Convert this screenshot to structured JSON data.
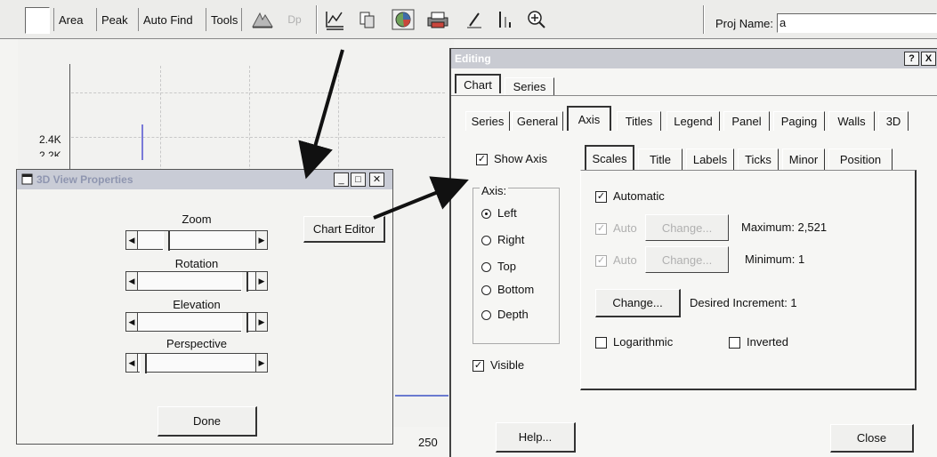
{
  "toolbar": {
    "area": "Area",
    "peak": "Peak",
    "auto_find": "Auto Find",
    "tools": "Tools",
    "dp": "Dp",
    "proj_name_label": "Proj Name:",
    "proj_name_value": "a"
  },
  "chart": {
    "y_ticks": [
      "2.4K",
      "2.2K"
    ],
    "x_tick": "250"
  },
  "view3d": {
    "title": "3D View Properties",
    "chart_editor": "Chart Editor",
    "zoom": "Zoom",
    "rotation": "Rotation",
    "elevation": "Elevation",
    "perspective": "Perspective",
    "done": "Done"
  },
  "editing": {
    "title": "Editing",
    "top_tabs": [
      "Chart",
      "Series"
    ],
    "chart_tabs": [
      "Series",
      "General",
      "Axis",
      "Titles",
      "Legend",
      "Panel",
      "Paging",
      "Walls",
      "3D"
    ],
    "show_axis": "Show Axis",
    "axis_group": "Axis:",
    "axis_options": [
      "Left",
      "Right",
      "Top",
      "Bottom",
      "Depth"
    ],
    "visible": "Visible",
    "axis_tabs": [
      "Scales",
      "Title",
      "Labels",
      "Ticks",
      "Minor",
      "Position"
    ],
    "automatic": "Automatic",
    "auto": "Auto",
    "change": "Change...",
    "maximum": "Maximum: 2,521",
    "minimum": "Minimum: 1",
    "desired_increment": "Desired Increment: 1",
    "logarithmic": "Logarithmic",
    "inverted": "Inverted",
    "help": "Help...",
    "close": "Close",
    "help_q": "?",
    "close_x": "X"
  }
}
